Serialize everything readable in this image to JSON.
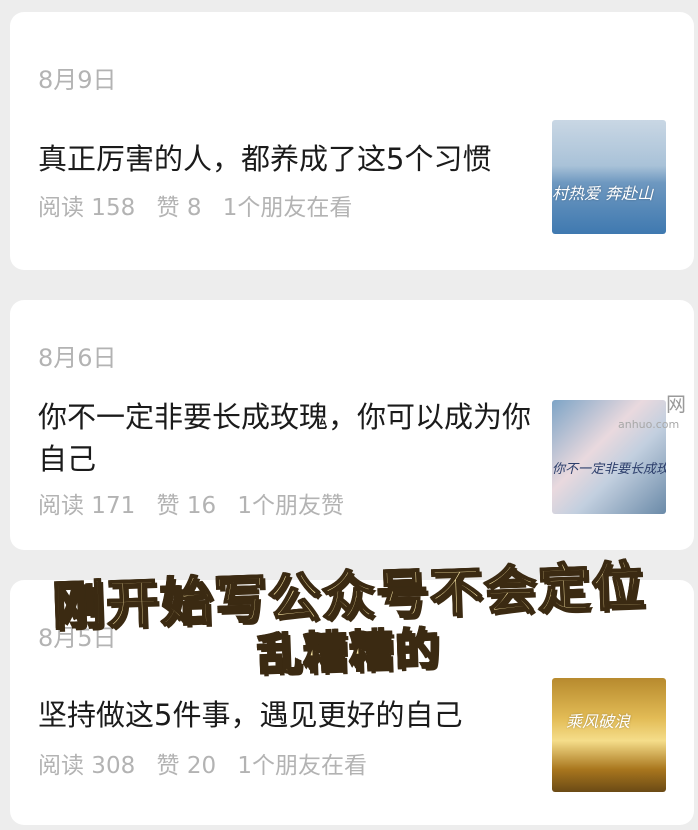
{
  "articles": [
    {
      "date": "8月9日",
      "title": "真正厉害的人，都养成了这5个习惯",
      "reads": "阅读 158",
      "likes": "赞 8",
      "social": "1个朋友在看",
      "thumb_text": "村热爱 奔赴山",
      "thumb_icon": "landscape-thumbnail"
    },
    {
      "date": "8月6日",
      "title": "你不一定非要长成玫瑰，你可以成为你自己",
      "reads": "阅读 171",
      "likes": "赞 16",
      "social": "1个朋友赞",
      "thumb_text": "你不一定非要长成玫",
      "thumb_icon": "book-thumbnail"
    },
    {
      "date": "8月5日",
      "title": "坚持做这5件事，遇见更好的自己",
      "reads": "阅读 308",
      "likes": "赞 20",
      "social": "1个朋友在看",
      "thumb_text": "乘风破浪",
      "thumb_icon": "sunset-sea-thumbnail"
    }
  ],
  "overlay": {
    "line1": "刚开始写公众号不会定位",
    "line2": "乱糟糟的"
  },
  "watermark": {
    "char": "网",
    "url": "anhuo.com"
  },
  "colors": {
    "background": "#ededed",
    "card": "#ffffff",
    "title": "#1b1b1b",
    "meta": "#b3b3b3",
    "overlay_fill": "#fbe9a8",
    "overlay_stroke": "#3b2a12"
  }
}
